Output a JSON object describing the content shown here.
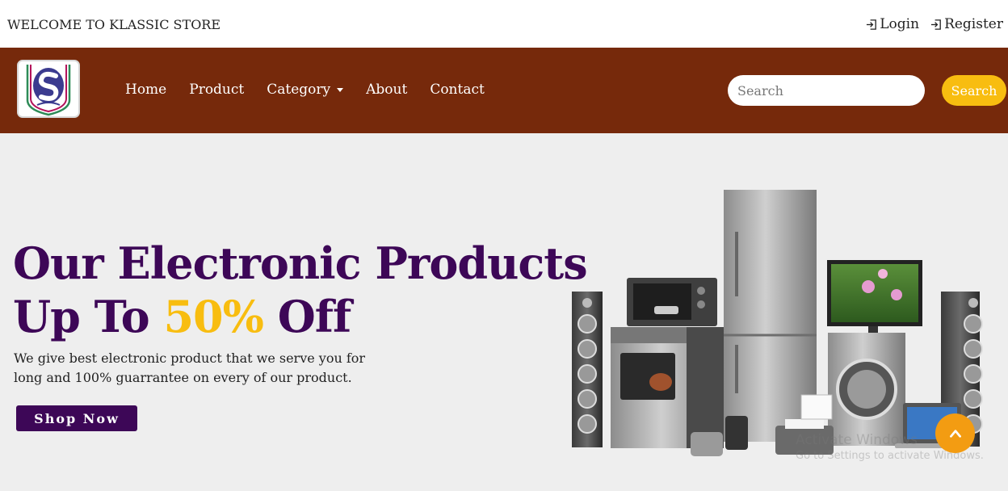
{
  "topbar": {
    "welcome": "WELCOME TO KLASSIC STORE",
    "login": "Login",
    "register": "Register"
  },
  "nav": {
    "items": [
      "Home",
      "Product",
      "Category",
      "About",
      "Contact"
    ]
  },
  "search": {
    "placeholder": "Search",
    "button": "Search"
  },
  "hero": {
    "line1": "Our Electronic Products",
    "line2_prefix": "Up To ",
    "line2_highlight": "50%",
    "line2_suffix": " Off",
    "description": "We give best electronic product that we serve you for long and 100% guarrantee on every of our product.",
    "cta": "Shop Now"
  },
  "watermark": {
    "line1": "Activate Windows",
    "line2": "Go to Settings to activate Windows."
  },
  "colors": {
    "navbar": "#76290b",
    "accent": "#f8bd10",
    "headline": "#3d0757",
    "scroll_button": "#f39c12"
  },
  "icons": {
    "login": "login-icon",
    "register": "register-icon",
    "dropdown": "chevron-down-icon",
    "scroll_top": "chevron-up-icon"
  }
}
